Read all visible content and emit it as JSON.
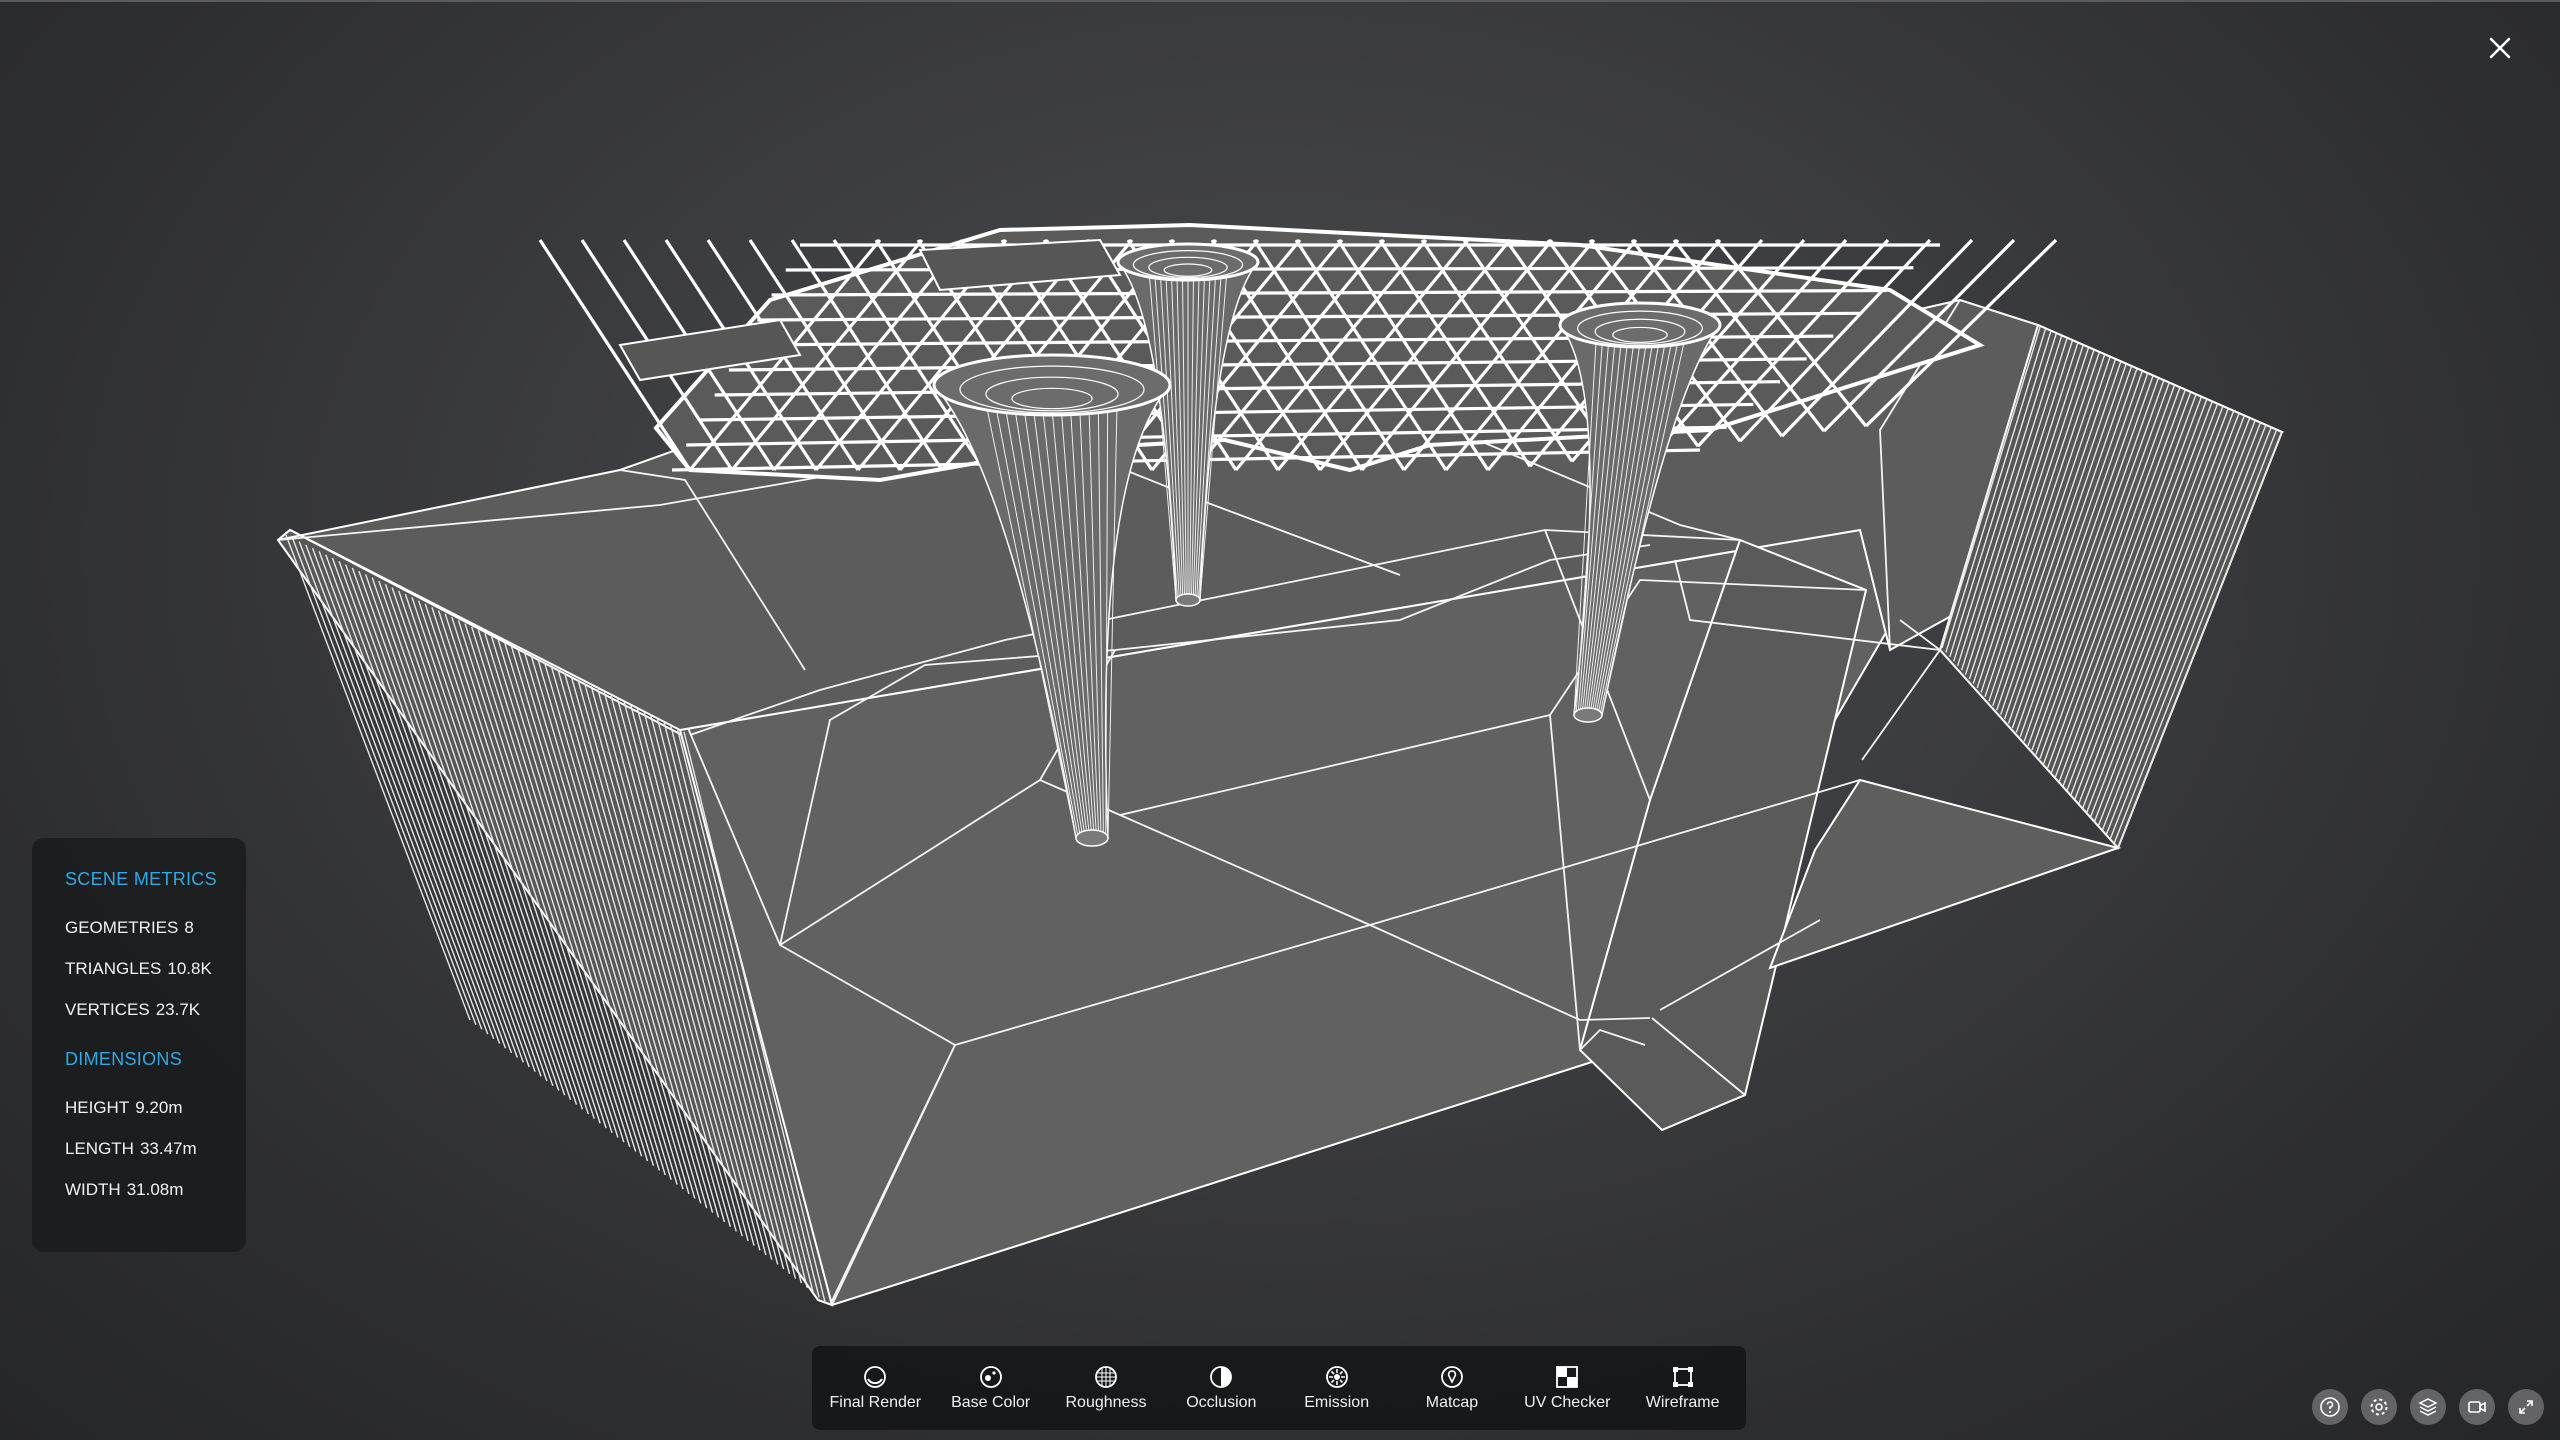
{
  "viewer": {
    "close_icon": "close-icon"
  },
  "scene_metrics": {
    "title": "SCENE METRICS",
    "geometries_label": "GEOMETRIES",
    "geometries_value": "8",
    "triangles_label": "TRIANGLES",
    "triangles_value": "10.8K",
    "vertices_label": "VERTICES",
    "vertices_value": "23.7K"
  },
  "dimensions": {
    "title": "DIMENSIONS",
    "height_label": "HEIGHT",
    "height_value": "9.20m",
    "length_label": "LENGTH",
    "length_value": "33.47m",
    "width_label": "WIDTH",
    "width_value": "31.08m"
  },
  "toolbar": {
    "modes": [
      {
        "label": "Final Render",
        "icon": "final-render-icon"
      },
      {
        "label": "Base Color",
        "icon": "base-color-icon"
      },
      {
        "label": "Roughness",
        "icon": "roughness-icon"
      },
      {
        "label": "Occlusion",
        "icon": "occlusion-icon"
      },
      {
        "label": "Emission",
        "icon": "emission-icon"
      },
      {
        "label": "Matcap",
        "icon": "matcap-icon"
      },
      {
        "label": "UV Checker",
        "icon": "uv-checker-icon"
      },
      {
        "label": "Wireframe",
        "icon": "wireframe-icon"
      }
    ]
  },
  "corner_controls": [
    "help-icon",
    "settings-icon",
    "layers-icon",
    "camera-icon",
    "fullscreen-icon"
  ],
  "colors": {
    "accent": "#2fa9e8",
    "wire": "#ffffff",
    "model_face": "#5f5f60"
  }
}
